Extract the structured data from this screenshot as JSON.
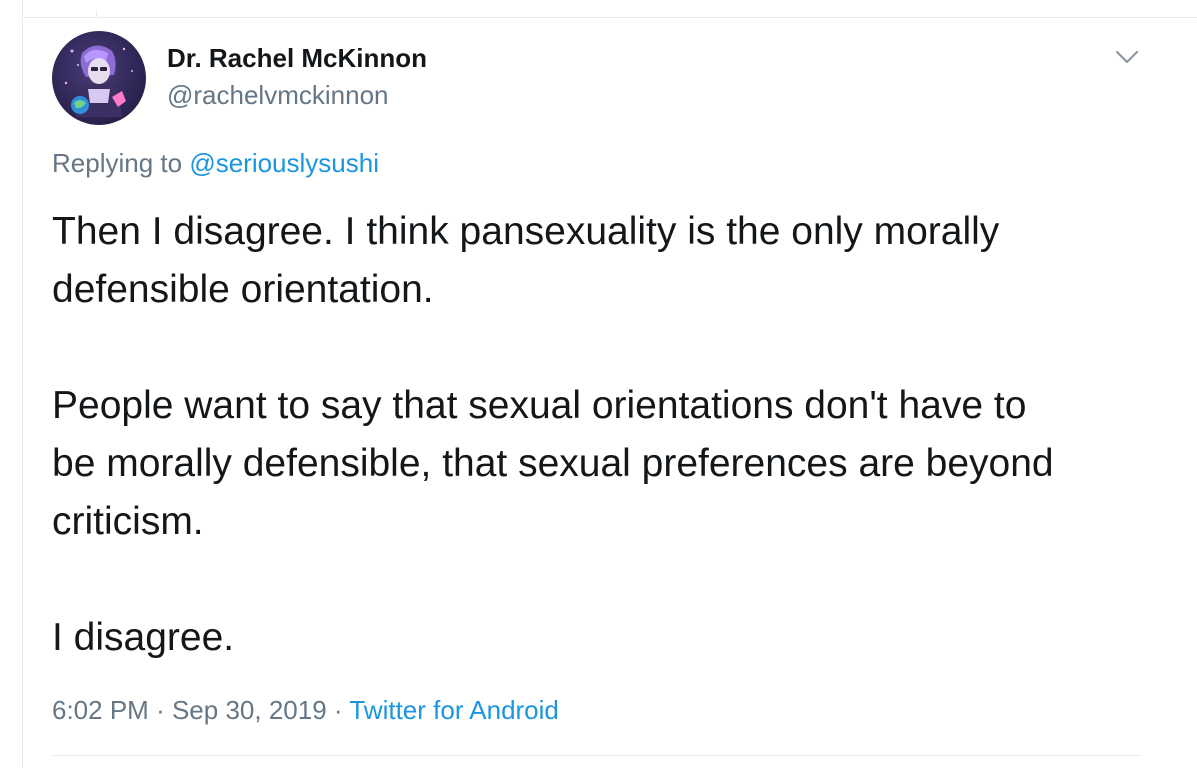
{
  "tweet": {
    "author": {
      "display_name": "Dr. Rachel McKinnon",
      "handle": "@rachelvmckinnon",
      "avatar_icon": "profile-avatar"
    },
    "caret_icon": "chevron-down-icon",
    "reply": {
      "prefix": "Replying to",
      "mention": "@seriouslysushi"
    },
    "paragraphs": [
      "Then I disagree. I think pansexuality is the only morally\ndefensible orientation.",
      "People want to say that sexual orientations don't have to\nbe morally defensible, that sexual preferences are beyond\ncriticism.",
      "I disagree."
    ],
    "meta": {
      "time": "6:02 PM",
      "separator": "·",
      "date": "Sep 30, 2019",
      "source": "Twitter for Android"
    }
  },
  "colors": {
    "text": "#14171a",
    "secondary": "#657786",
    "link": "#1b95e0",
    "border": "#e6ecf0"
  }
}
